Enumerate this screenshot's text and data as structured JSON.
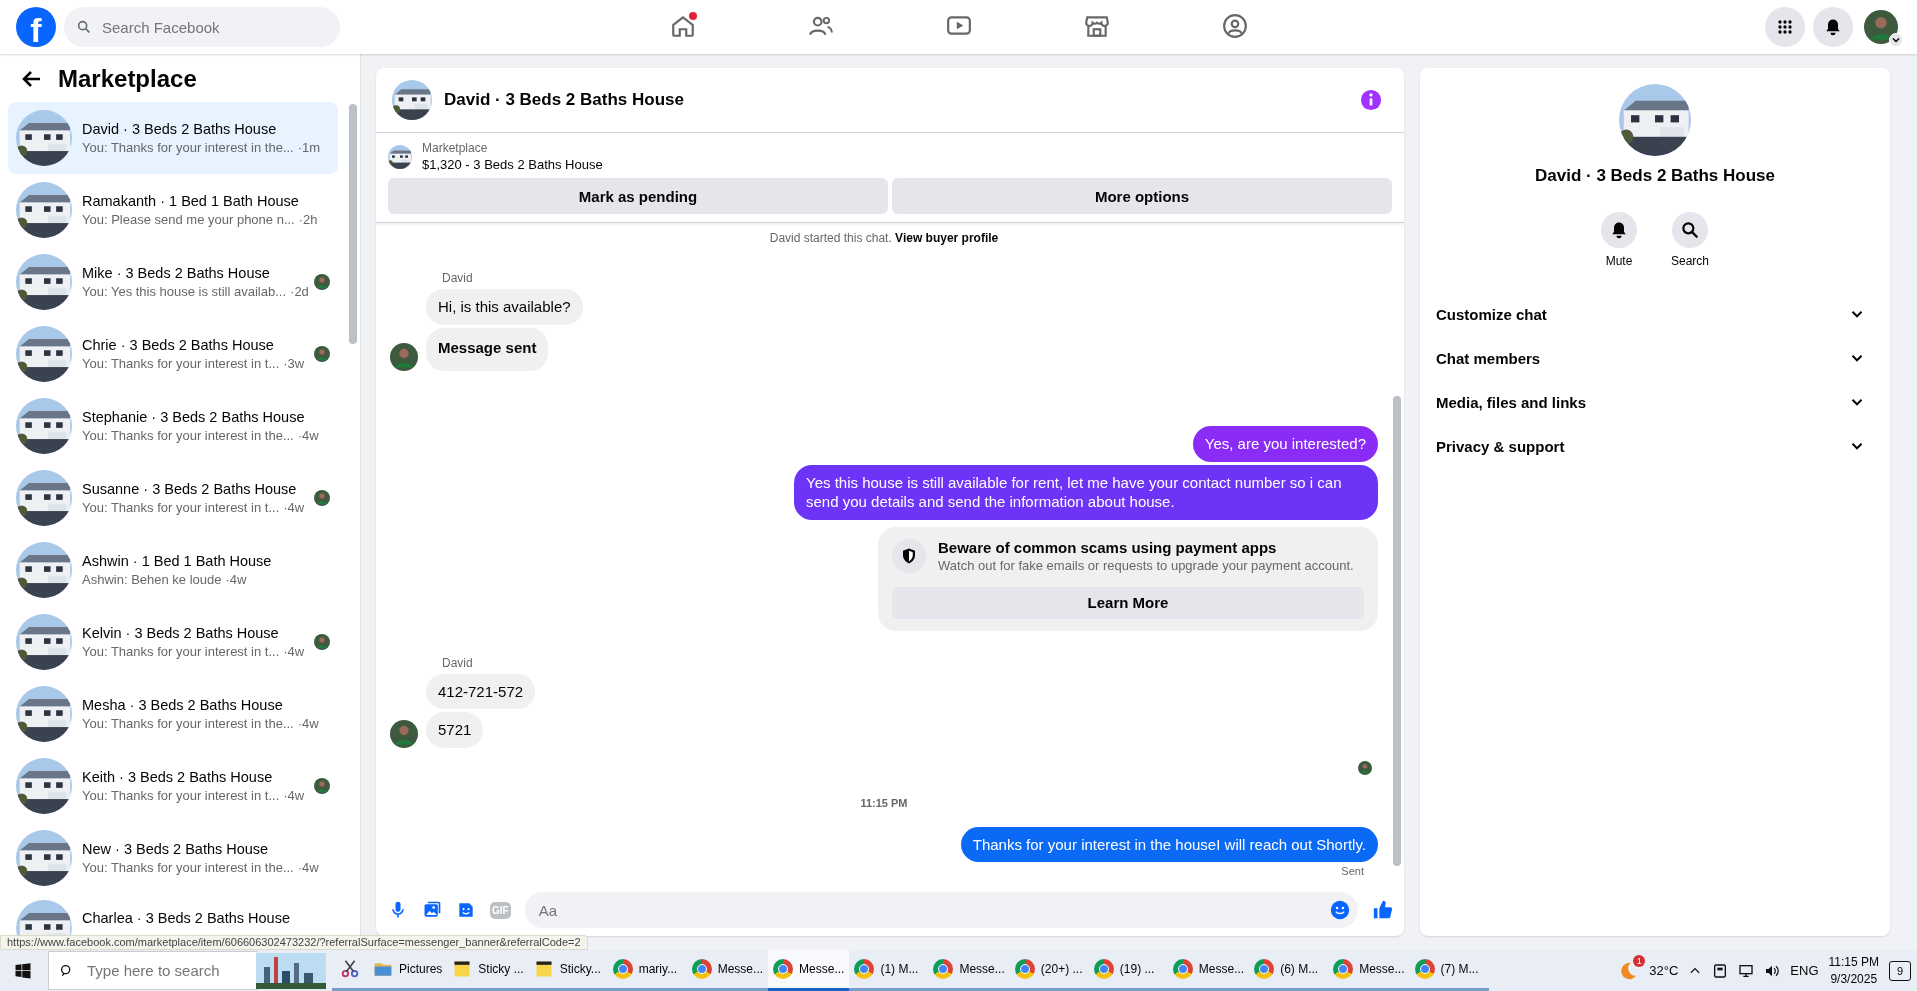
{
  "top_bar": {
    "logo": "f",
    "search": {
      "placeholder": "Search Facebook"
    },
    "nav": [
      {
        "kind": "home",
        "badge": true,
        "selected": false
      },
      {
        "kind": "friends",
        "badge": false,
        "selected": false
      },
      {
        "kind": "video",
        "badge": false,
        "selected": false
      },
      {
        "kind": "marketplace",
        "badge": false,
        "selected": false
      },
      {
        "kind": "groups",
        "badge": false,
        "selected": false
      }
    ],
    "actions": [
      {
        "kind": "menu"
      },
      {
        "kind": "bell"
      },
      {
        "kind": "profile"
      }
    ]
  },
  "sidebar": {
    "title": "Marketplace",
    "conversations": [
      {
        "name": "David · 3 Beds 2 Baths House",
        "preview": "You: Thanks for your interest in the...",
        "time": "·1m",
        "selected": true,
        "seen": false
      },
      {
        "name": "Ramakanth · 1 Bed 1 Bath House",
        "preview": "You: Please send me your phone n...",
        "time": "·2h",
        "selected": false,
        "seen": false
      },
      {
        "name": "Mike · 3 Beds 2 Baths House",
        "preview": "You: Yes this house is still availab...",
        "time": "·2d",
        "selected": false,
        "seen": true
      },
      {
        "name": "Chrie · 3 Beds 2 Baths House",
        "preview": "You: Thanks for your interest in t...",
        "time": "·3w",
        "selected": false,
        "seen": true
      },
      {
        "name": "Stephanie · 3 Beds 2 Baths House",
        "preview": "You: Thanks for your interest in the...",
        "time": "·4w",
        "selected": false,
        "seen": false
      },
      {
        "name": "Susanne · 3 Beds 2 Baths House",
        "preview": "You: Thanks for your interest in t...",
        "time": "·4w",
        "selected": false,
        "seen": true
      },
      {
        "name": "Ashwin · 1 Bed 1 Bath House",
        "preview": "Ashwin: Behen ke loude",
        "time": "·4w",
        "selected": false,
        "seen": false
      },
      {
        "name": "Kelvin · 3 Beds 2 Baths House",
        "preview": "You: Thanks for your interest in t...",
        "time": "·4w",
        "selected": false,
        "seen": true
      },
      {
        "name": "Mesha · 3 Beds 2 Baths House",
        "preview": "You: Thanks for your interest in the...",
        "time": "·4w",
        "selected": false,
        "seen": false
      },
      {
        "name": "Keith · 3 Beds 2 Baths House",
        "preview": "You: Thanks for your interest in t...",
        "time": "·4w",
        "selected": false,
        "seen": true
      },
      {
        "name": "New · 3 Beds 2 Baths House",
        "preview": "You: Thanks for your interest in the...",
        "time": "·4w",
        "selected": false,
        "seen": false
      },
      {
        "name": "Charlea · 3 Beds 2 Baths House",
        "selected": false,
        "seen": false
      }
    ]
  },
  "chat": {
    "title": "David · 3 Beds 2 Baths House",
    "listing": {
      "source": "Marketplace",
      "item": "$1,320 - 3 Beds 2 Baths House",
      "buttons": [
        "Mark as pending",
        "More options"
      ]
    },
    "messages": [
      {
        "kind": "system",
        "text": "David started this chat.",
        "link": "View buyer profile"
      },
      {
        "kind": "sender",
        "text": "David"
      },
      {
        "kind": "incoming",
        "text": "Hi, is this available?",
        "bold": false,
        "avatar": false
      },
      {
        "kind": "incoming",
        "text": "Message sent",
        "bold": true,
        "avatar": true
      },
      {
        "kind": "outgoing",
        "text": "Yes, are you interested?",
        "color": "#8a2cf5"
      },
      {
        "kind": "outgoing",
        "text": "Yes this house is still available for rent, let me have your contact number so i can send you details and send the information about house.",
        "color": "#6d33f7"
      },
      {
        "kind": "warning",
        "title": "Beware of common scams using payment apps",
        "text": "Watch out for fake emails or requests to upgrade your payment account.",
        "button": "Learn More"
      },
      {
        "kind": "sender",
        "text": "David"
      },
      {
        "kind": "incoming",
        "text": "412-721-572",
        "bold": false,
        "avatar": false
      },
      {
        "kind": "incoming",
        "text": "5721",
        "bold": false,
        "avatar": true
      },
      {
        "kind": "seen"
      },
      {
        "kind": "timestamp",
        "text": "11:15 PM"
      },
      {
        "kind": "outgoing",
        "text": "Thanks for your interest in the houseI will reach out Shortly.",
        "color": "#0a6af5"
      },
      {
        "kind": "status",
        "text": "Sent"
      }
    ],
    "composer": {
      "gif": "GIF",
      "placeholder": "Aa"
    }
  },
  "details": {
    "title": "David · 3 Beds 2 Baths House",
    "actions": [
      {
        "kind": "bell",
        "label": "Mute"
      },
      {
        "kind": "search",
        "label": "Search"
      }
    ],
    "sections": [
      {
        "label": "Customize chat",
        "expanded": false
      },
      {
        "label": "Chat members",
        "expanded": false
      },
      {
        "label": "Media, files and links",
        "expanded": false
      },
      {
        "label": "Privacy & support",
        "expanded": false
      }
    ]
  },
  "status_url": "https://www.facebook.com/marketplace/item/606606302473232/?referralSurface=messenger_banner&referralCode=2",
  "taskbar": {
    "search_placeholder": "Type here to search",
    "apps": [
      {
        "kind": "snip",
        "selected": false
      },
      {
        "kind": "folder",
        "label": "Pictures",
        "selected": false
      },
      {
        "kind": "sticky",
        "label": "Sticky ...",
        "selected": false
      },
      {
        "kind": "sticky",
        "label": "Sticky...",
        "selected": false
      },
      {
        "kind": "chrome",
        "label": "mariy...",
        "selected": false
      },
      {
        "kind": "chrome",
        "label": "Messe...",
        "selected": false
      },
      {
        "kind": "chrome",
        "label": "Messe...",
        "selected": true
      },
      {
        "kind": "chrome",
        "label": "(1) M...",
        "selected": false
      },
      {
        "kind": "chrome",
        "label": "Messe...",
        "selected": false
      },
      {
        "kind": "chrome",
        "label": "(20+) ...",
        "selected": false
      },
      {
        "kind": "chrome",
        "label": "(19) ...",
        "selected": false
      },
      {
        "kind": "chrome",
        "label": "Messe...",
        "selected": false
      },
      {
        "kind": "chrome",
        "label": "(6) M...",
        "selected": false
      },
      {
        "kind": "chrome",
        "label": "Messe...",
        "selected": false
      },
      {
        "kind": "chrome",
        "label": "(7) M...",
        "selected": false
      }
    ],
    "weather": {
      "badge": "1",
      "temperature": "32°C"
    },
    "language": "ENG",
    "time": "11:15 PM",
    "date": "9/3/2025",
    "notifications": "9"
  }
}
